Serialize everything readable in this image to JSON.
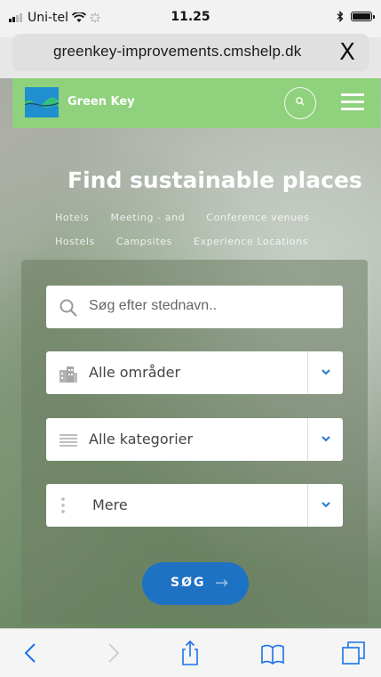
{
  "status_bar": {
    "carrier": "Uni-tel",
    "time": "11.25",
    "icons": [
      "signal-icon",
      "wifi-icon",
      "activity-icon",
      "bluetooth-icon",
      "battery-icon"
    ]
  },
  "browser": {
    "url": "greenkey-improvements.cmshelp.dk",
    "close_label": "X"
  },
  "site": {
    "brand": "Green Key",
    "header_color": "#8fd17c",
    "logo_color": "#1f8fd0"
  },
  "hero": {
    "title": "Find sustainable places",
    "categories": [
      "Hotels",
      "Meeting - and",
      "Conference venues",
      "Hostels",
      "Campsites",
      "Experience Locations"
    ]
  },
  "search_form": {
    "place_placeholder": "Søg efter stednavn..",
    "area_select": "Alle områder",
    "category_select": "Alle kategorier",
    "more_select": "Mere",
    "submit_label": "SØG",
    "submit_arrow": "→",
    "button_color": "#1e72c4"
  },
  "toolbar": {
    "icons": [
      "back-icon",
      "forward-icon",
      "share-icon",
      "bookmarks-icon",
      "tabs-icon"
    ],
    "accent": "#1a73e8"
  }
}
